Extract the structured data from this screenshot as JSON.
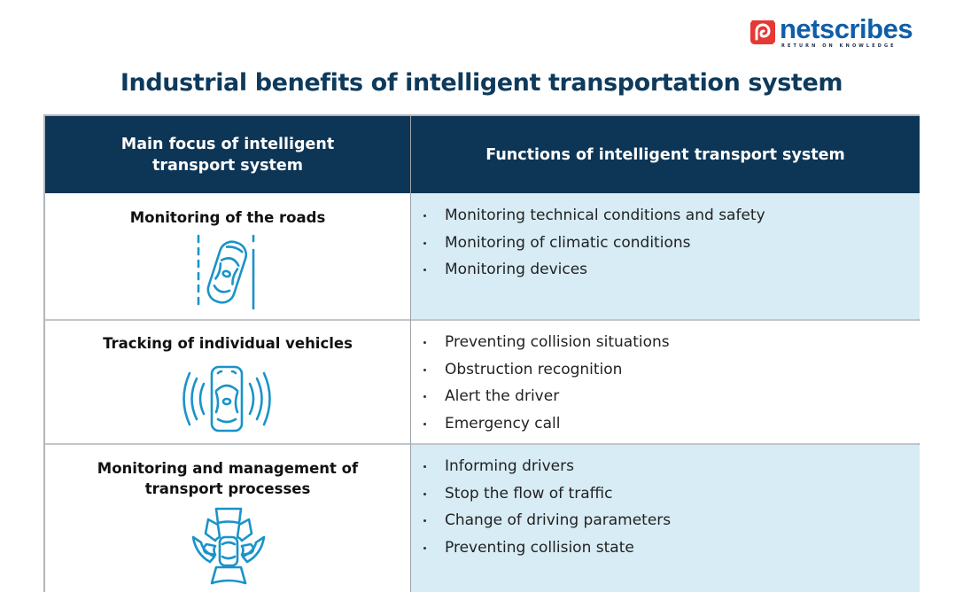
{
  "brand": {
    "name": "netscribes",
    "tagline": "RETURN ON KNOWLEDGE",
    "colors": {
      "wordmark": "#0f5ea8",
      "mark": "#e53935"
    }
  },
  "title": "Industrial benefits of intelligent transportation system",
  "colors": {
    "header_bg": "#0c3556",
    "accent_icon": "#1a93c9",
    "row_highlight": "#d7ecf5"
  },
  "table": {
    "headers": [
      "Main focus of intelligent transport system",
      "Functions of intelligent transport system"
    ],
    "rows": [
      {
        "focus": "Monitoring of the roads",
        "icon": "car-in-lane-icon",
        "functions": [
          "Monitoring technical conditions and safety",
          "Monitoring of climatic conditions",
          "Monitoring devices"
        ]
      },
      {
        "focus": "Tracking of individual vehicles",
        "icon": "car-signal-icon",
        "functions": [
          "Preventing collision situations",
          "Obstruction recognition",
          "Alert the driver",
          "Emergency call"
        ]
      },
      {
        "focus": "Monitoring and management of transport processes",
        "icon": "car-sensor-zones-icon",
        "functions": [
          "Informing drivers",
          "Stop the flow of traffic",
          "Change of driving parameters",
          "Preventing collision state"
        ]
      }
    ]
  }
}
